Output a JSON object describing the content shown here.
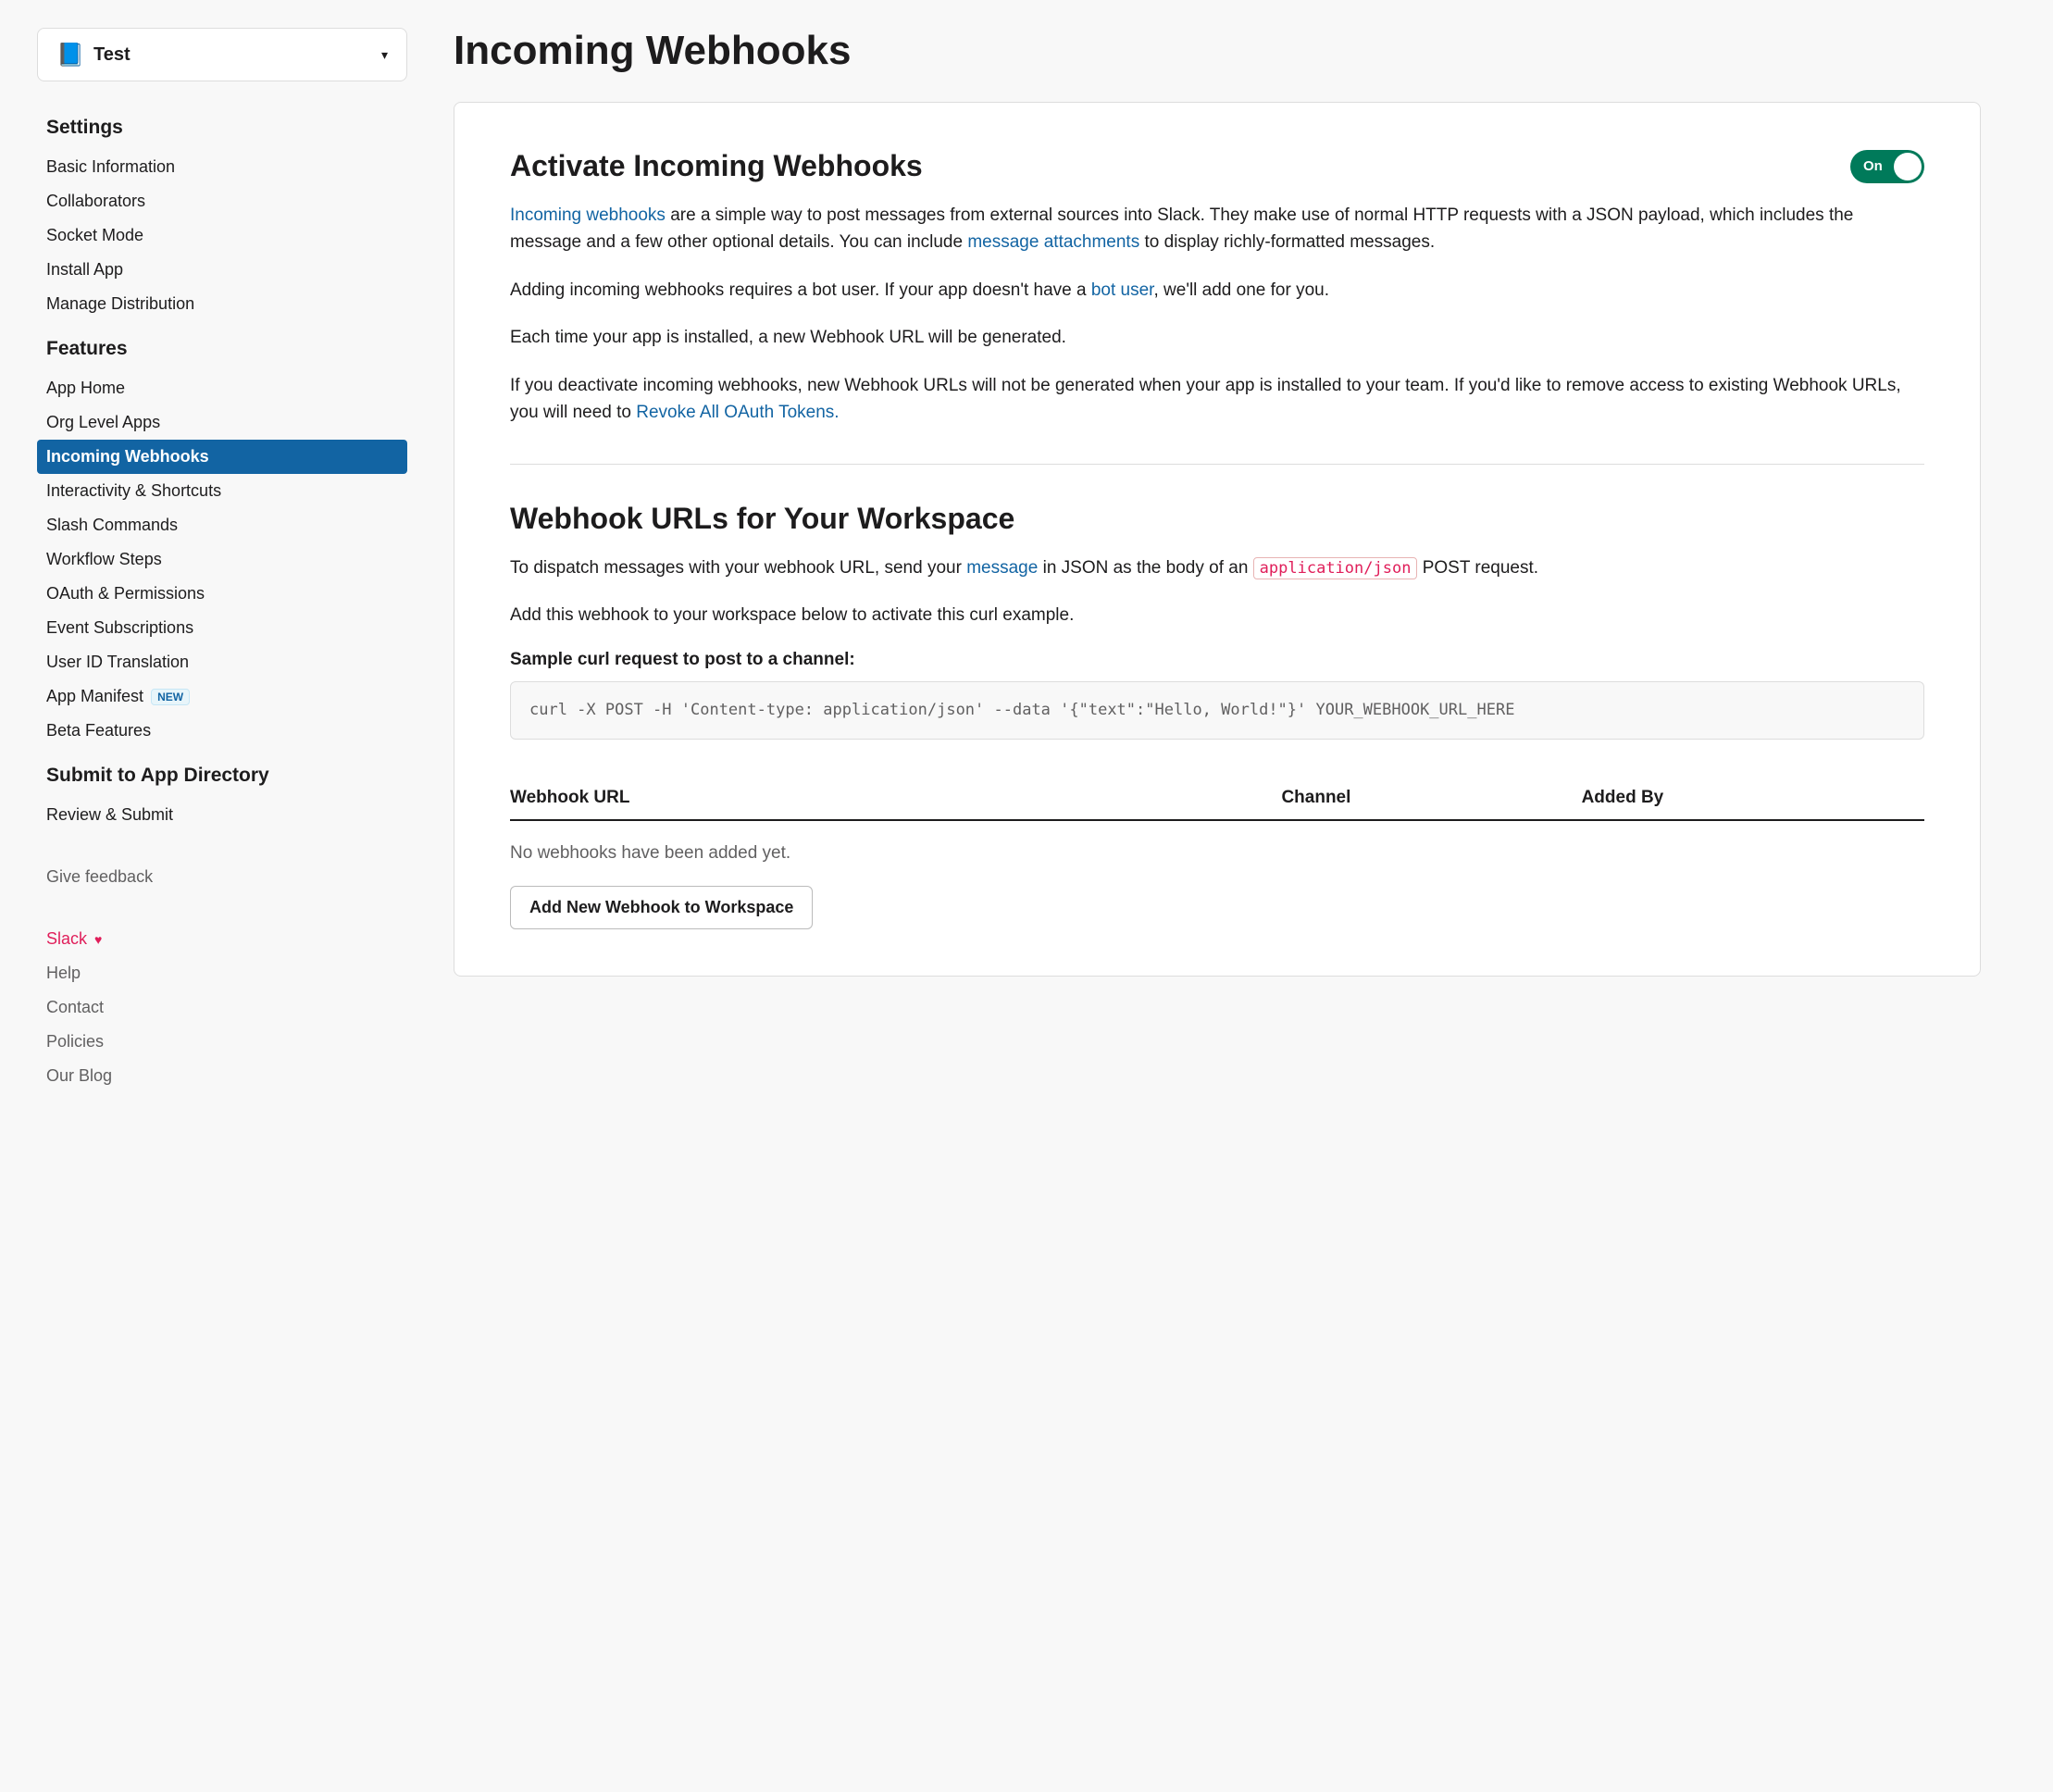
{
  "app_selector": {
    "name": "Test"
  },
  "sidebar": {
    "sections": [
      {
        "heading": "Settings",
        "items": [
          {
            "label": "Basic Information"
          },
          {
            "label": "Collaborators"
          },
          {
            "label": "Socket Mode"
          },
          {
            "label": "Install App"
          },
          {
            "label": "Manage Distribution"
          }
        ]
      },
      {
        "heading": "Features",
        "items": [
          {
            "label": "App Home"
          },
          {
            "label": "Org Level Apps"
          },
          {
            "label": "Incoming Webhooks",
            "active": true
          },
          {
            "label": "Interactivity & Shortcuts"
          },
          {
            "label": "Slash Commands"
          },
          {
            "label": "Workflow Steps"
          },
          {
            "label": "OAuth & Permissions"
          },
          {
            "label": "Event Subscriptions"
          },
          {
            "label": "User ID Translation"
          },
          {
            "label": "App Manifest",
            "badge": "NEW"
          },
          {
            "label": "Beta Features"
          }
        ]
      },
      {
        "heading": "Submit to App Directory",
        "items": [
          {
            "label": "Review & Submit"
          }
        ]
      }
    ],
    "footer_links": [
      {
        "label": "Give feedback",
        "muted": true
      },
      {
        "label": "Slack",
        "pink": true,
        "heart": true
      },
      {
        "label": "Help",
        "muted": true
      },
      {
        "label": "Contact",
        "muted": true
      },
      {
        "label": "Policies",
        "muted": true
      },
      {
        "label": "Our Blog",
        "muted": true
      }
    ]
  },
  "page": {
    "title": "Incoming Webhooks"
  },
  "activate": {
    "title": "Activate Incoming Webhooks",
    "toggle_state": "On",
    "p1_link1": "Incoming webhooks",
    "p1_text1": " are a simple way to post messages from external sources into Slack. They make use of normal HTTP requests with a JSON payload, which includes the message and a few other optional details. You can include ",
    "p1_link2": "message attachments",
    "p1_text2": " to display richly-formatted messages.",
    "p2_text1": "Adding incoming webhooks requires a bot user. If your app doesn't have a ",
    "p2_link1": "bot user",
    "p2_text2": ", we'll add one for you.",
    "p3": "Each time your app is installed, a new Webhook URL will be generated.",
    "p4_text1": "If you deactivate incoming webhooks, new Webhook URLs will not be generated when your app is installed to your team. If you'd like to remove access to existing Webhook URLs, you will need to ",
    "p4_link1": "Revoke All OAuth Tokens."
  },
  "workspace": {
    "title": "Webhook URLs for Your Workspace",
    "p1_text1": "To dispatch messages with your webhook URL, send your ",
    "p1_link1": "message",
    "p1_text2": " in JSON as the body of an ",
    "p1_code": "application/json",
    "p1_text3": " POST request.",
    "p2": "Add this webhook to your workspace below to activate this curl example.",
    "sample_label": "Sample curl request to post to a channel:",
    "curl_code": "curl -X POST -H 'Content-type: application/json' --data '{\"text\":\"Hello, World!\"}' YOUR_WEBHOOK_URL_HERE",
    "table": {
      "col_url": "Webhook URL",
      "col_channel": "Channel",
      "col_added": "Added By",
      "empty": "No webhooks have been added yet."
    },
    "add_button": "Add New Webhook to Workspace"
  }
}
